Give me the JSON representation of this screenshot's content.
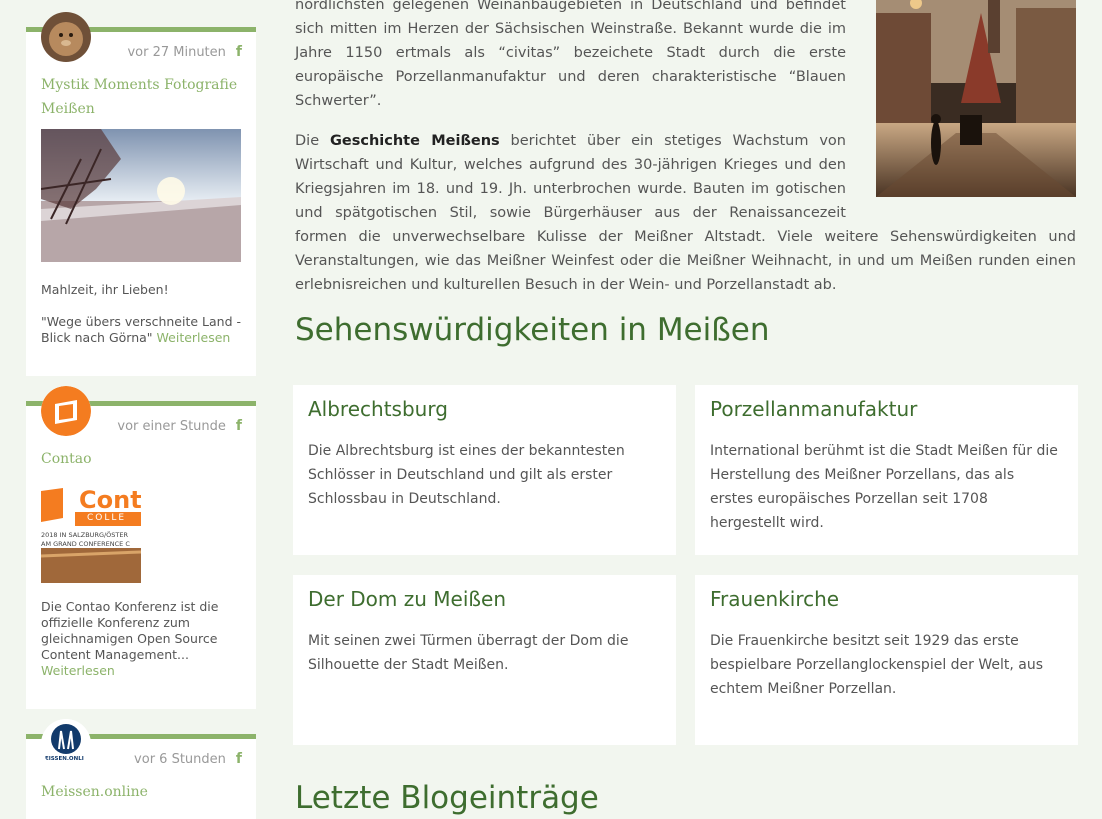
{
  "feed": [
    {
      "time": "vor 27 Minuten",
      "source_icon": "facebook-icon",
      "title": "Mystik Moments Fotografie Meißen",
      "text1": "Mahlzeit, ihr Lieben!",
      "text2": "\"Wege übers verschneite Land - Blick nach Görna\"",
      "more": "Weiterlesen"
    },
    {
      "time": "vor einer Stunde",
      "source_icon": "facebook-icon",
      "title": "Contao",
      "image_lines": [
        "Conta",
        "COLLE",
        "2018 IN SALZBURG/ÖSTER",
        "AM GRAND CONFERENCE C"
      ],
      "text1": "Die Contao Konferenz ist die offizielle Konferenz zum gleichnamigen Open Source Content Management...",
      "more": "Weiterlesen"
    },
    {
      "time": "vor 6 Stunden",
      "source_icon": "facebook-icon",
      "title": "Meissen.online",
      "avatar_caption": "EISSEN.ONLI"
    }
  ],
  "intro": {
    "p1": "nördlichsten gelegenen Weinanbaugebieten in Deutschland und befindet sich mitten im Herzen der Sächsischen Weinstraße. Bekannt wurde die im Jahre 1150 ertmals als “civitas” bezeichete Stadt durch die erste europäische Porzellanmanufaktur und deren charakteristische “Blauen Schwerter”.",
    "p2_prefix": "Die ",
    "p2_strong": "Geschichte Meißens",
    "p2_rest": " berichtet über ein stetiges Wachstum von Wirtschaft und Kultur, welches aufgrund des 30-jährigen Krieges und den Kriegsjahren im 18. und 19. Jh. unterbrochen wurde. Bauten im gotischen und spätgotischen Stil, sowie Bürgerhäuser aus der Renaissancezeit formen die unverwechselbare Kulisse der Meißner Altstadt. Viele weitere Sehenswürdigkeiten und Veranstaltungen, wie das Meißner Weinfest oder die Meißner Weihnacht, in und um Meißen runden einen erlebnisreichen und kulturellen Besuch in der Wein- und Porzellanstadt ab."
  },
  "sights_heading": "Sehenswürdigkeiten in Meißen",
  "sights": [
    {
      "title": "Albrechtsburg",
      "text": "Die Albrechtsburg ist eines der bekanntesten Schlösser in Deutschland und gilt als erster Schlossbau in Deutschland."
    },
    {
      "title": "Porzellanmanufaktur",
      "text": "International berühmt ist die Stadt Meißen für die Herstellung des Meißner Porzellans, das als erstes europäisches Porzellan seit 1708 hergestellt wird."
    },
    {
      "title": "Der Dom zu Meißen",
      "text": "Mit seinen zwei Türmen überragt der Dom die Silhouette der Stadt Meißen."
    },
    {
      "title": "Frauenkirche",
      "text": "Die Frauenkirche besitzt seit 1929 das erste bespielbare Porzellanglockenspiel der Welt, aus echtem Meißner Porzellan."
    }
  ],
  "blog_heading": "Letzte Blogeinträge",
  "colors": {
    "accent": "#8cb36a",
    "heading": "#3e6d2f",
    "background": "#f2f6ef"
  }
}
